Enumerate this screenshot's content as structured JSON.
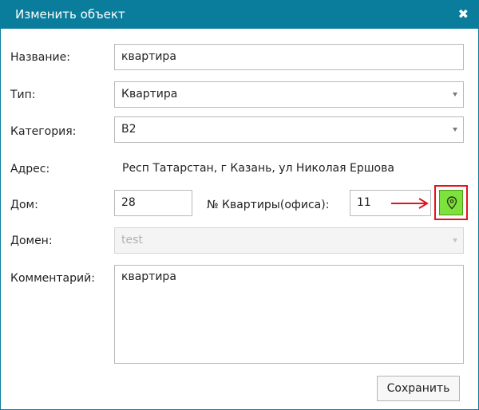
{
  "dialog": {
    "title": "Изменить объект",
    "close_icon": "close-icon"
  },
  "form": {
    "name": {
      "label": "Название:",
      "value": "квартира"
    },
    "type": {
      "label": "Тип:",
      "value": "Квартира"
    },
    "category": {
      "label": "Категория:",
      "value": "B2"
    },
    "address": {
      "label": "Адрес:",
      "value": "Респ Татарстан, г Казань, ул Николая Ершова"
    },
    "house": {
      "label": "Дом:",
      "value": "28"
    },
    "apartment": {
      "label": "№ Квартиры(офиса):",
      "value": "11"
    },
    "domain": {
      "label": "Домен:",
      "value": "test",
      "disabled": true
    },
    "comment": {
      "label": "Комментарий:",
      "value": "квартира"
    }
  },
  "map_button": {
    "icon": "map-pin-icon",
    "color": "#7ee23d",
    "highlight_color": "#e3141a"
  },
  "actions": {
    "save_label": "Сохранить"
  },
  "colors": {
    "titlebar": "#0b7d9c"
  }
}
